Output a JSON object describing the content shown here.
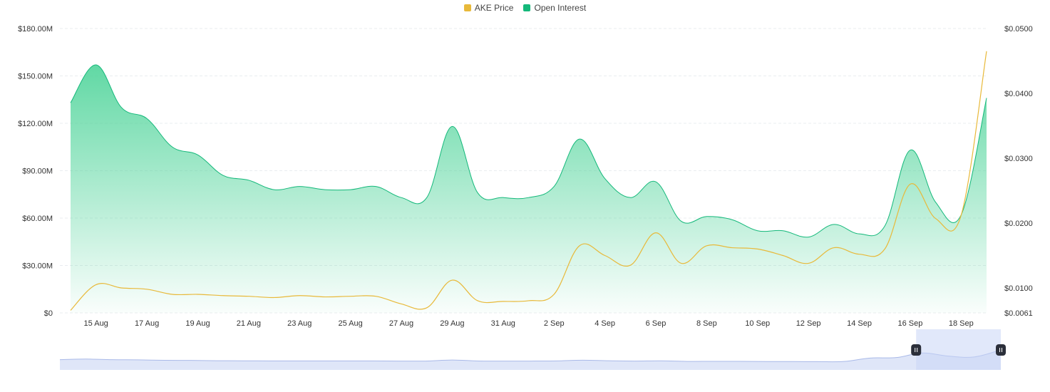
{
  "legend": {
    "price_label": "AKE Price",
    "oi_label": "Open Interest"
  },
  "colors": {
    "price": "#e8b93a",
    "oi_fill": "#4fd49a",
    "oi_line": "#14b87a",
    "brush_bg": "#e6ecfb",
    "brush_line": "#a9b9e8",
    "brush_handle": "#2b2f3a"
  },
  "chart_data": {
    "type": "area",
    "x_ticks": [
      "15 Aug",
      "17 Aug",
      "19 Aug",
      "21 Aug",
      "23 Aug",
      "25 Aug",
      "27 Aug",
      "29 Aug",
      "31 Aug",
      "2 Sep",
      "4 Sep",
      "6 Sep",
      "8 Sep",
      "10 Sep",
      "12 Sep",
      "14 Sep",
      "16 Sep",
      "18 Sep"
    ],
    "y_left": {
      "ticks": [
        "$0",
        "$30.00M",
        "$60.00M",
        "$90.00M",
        "$120.00M",
        "$150.00M",
        "$180.00M"
      ],
      "range": [
        0,
        180
      ]
    },
    "y_right": {
      "ticks": [
        "$0.0061",
        "$0.0100",
        "$0.0200",
        "$0.0300",
        "$0.0400",
        "$0.0500"
      ],
      "range": [
        0.0061,
        0.05
      ]
    },
    "series": [
      {
        "name": "Open Interest",
        "axis": "left",
        "unit": "M USD",
        "points": [
          [
            "14 Aug",
            133
          ],
          [
            "15 Aug",
            157
          ],
          [
            "16 Aug",
            130
          ],
          [
            "17 Aug",
            123
          ],
          [
            "18 Aug",
            105
          ],
          [
            "19 Aug",
            100
          ],
          [
            "20 Aug",
            87
          ],
          [
            "21 Aug",
            84
          ],
          [
            "22 Aug",
            78
          ],
          [
            "23 Aug",
            80
          ],
          [
            "24 Aug",
            78
          ],
          [
            "25 Aug",
            78
          ],
          [
            "26 Aug",
            80
          ],
          [
            "27 Aug",
            73
          ],
          [
            "28 Aug",
            73
          ],
          [
            "29 Aug",
            118
          ],
          [
            "30 Aug",
            76
          ],
          [
            "31 Aug",
            73
          ],
          [
            "1 Sep",
            73
          ],
          [
            "2 Sep",
            80
          ],
          [
            "3 Sep",
            110
          ],
          [
            "4 Sep",
            85
          ],
          [
            "5 Sep",
            73
          ],
          [
            "6 Sep",
            83
          ],
          [
            "7 Sep",
            58
          ],
          [
            "8 Sep",
            61
          ],
          [
            "9 Sep",
            59
          ],
          [
            "10 Sep",
            52
          ],
          [
            "11 Sep",
            52
          ],
          [
            "12 Sep",
            48
          ],
          [
            "13 Sep",
            56
          ],
          [
            "14 Sep",
            50
          ],
          [
            "15 Sep",
            55
          ],
          [
            "16 Sep",
            103
          ],
          [
            "17 Sep",
            70
          ],
          [
            "18 Sep",
            62
          ],
          [
            "19 Sep",
            136
          ]
        ]
      },
      {
        "name": "AKE Price",
        "axis": "right",
        "unit": "USD",
        "points": [
          [
            "14 Aug",
            0.0065
          ],
          [
            "15 Aug",
            0.0105
          ],
          [
            "16 Aug",
            0.01
          ],
          [
            "17 Aug",
            0.0098
          ],
          [
            "18 Aug",
            0.009
          ],
          [
            "19 Aug",
            0.009
          ],
          [
            "20 Aug",
            0.0088
          ],
          [
            "21 Aug",
            0.0087
          ],
          [
            "22 Aug",
            0.0085
          ],
          [
            "23 Aug",
            0.0088
          ],
          [
            "24 Aug",
            0.0086
          ],
          [
            "25 Aug",
            0.0087
          ],
          [
            "26 Aug",
            0.0087
          ],
          [
            "27 Aug",
            0.0075
          ],
          [
            "28 Aug",
            0.0069
          ],
          [
            "29 Aug",
            0.0112
          ],
          [
            "30 Aug",
            0.008
          ],
          [
            "31 Aug",
            0.0079
          ],
          [
            "1 Sep",
            0.008
          ],
          [
            "2 Sep",
            0.009
          ],
          [
            "3 Sep",
            0.0165
          ],
          [
            "4 Sep",
            0.015
          ],
          [
            "5 Sep",
            0.0135
          ],
          [
            "6 Sep",
            0.0185
          ],
          [
            "7 Sep",
            0.0138
          ],
          [
            "8 Sep",
            0.0165
          ],
          [
            "9 Sep",
            0.0162
          ],
          [
            "10 Sep",
            0.016
          ],
          [
            "11 Sep",
            0.015
          ],
          [
            "12 Sep",
            0.0138
          ],
          [
            "13 Sep",
            0.0162
          ],
          [
            "14 Sep",
            0.0152
          ],
          [
            "15 Sep",
            0.016
          ],
          [
            "16 Sep",
            0.026
          ],
          [
            "17 Sep",
            0.0207
          ],
          [
            "18 Sep",
            0.0212
          ],
          [
            "19 Sep",
            0.0465
          ]
        ]
      }
    ],
    "brush": {
      "selected_range_fraction": [
        0.91,
        1.0
      ]
    },
    "grid": true,
    "legend_position": "top-center"
  }
}
